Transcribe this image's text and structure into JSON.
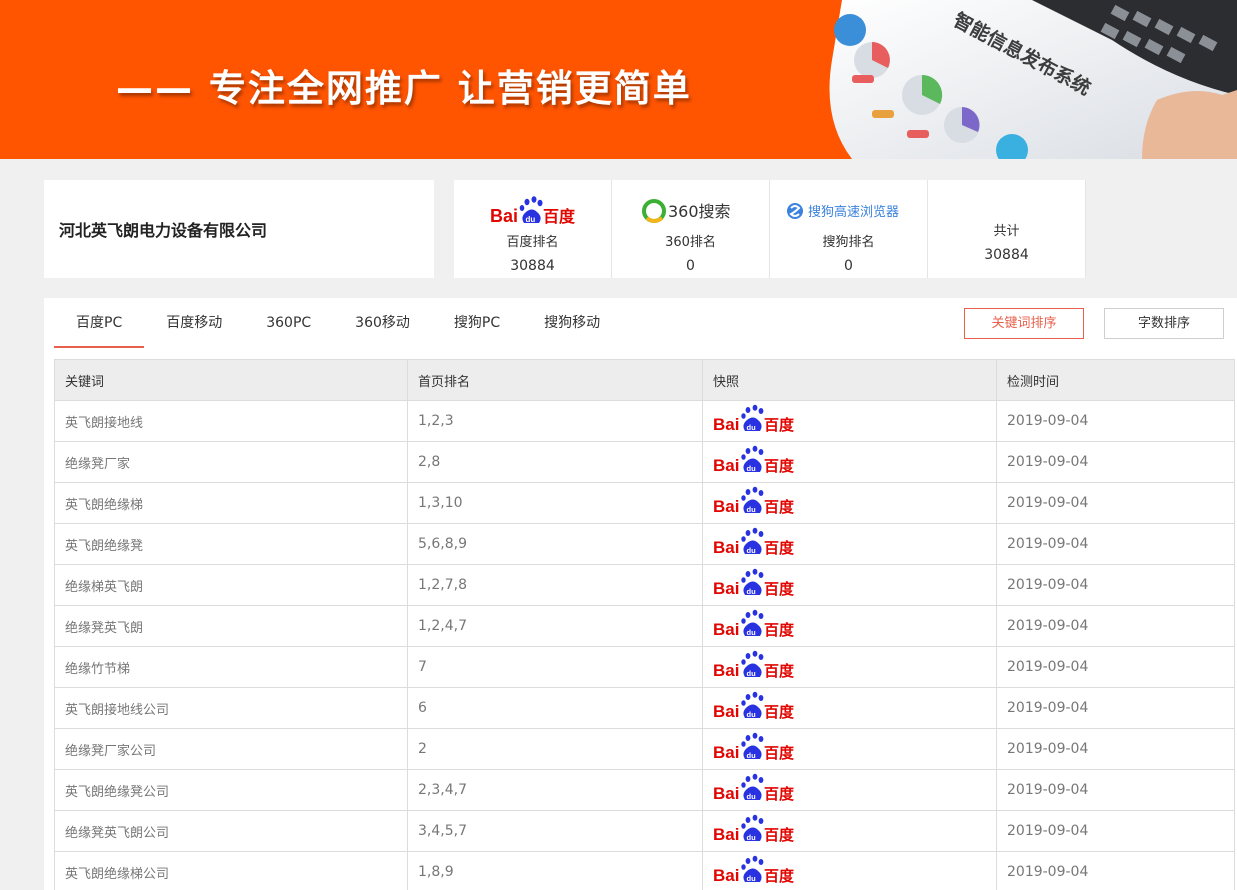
{
  "banner": {
    "slogan": "—— 专注全网推广    让营销更简单",
    "image_caption": "智能信息发布系统"
  },
  "company": {
    "name": "河北英飞朗电力设备有限公司"
  },
  "stats": [
    {
      "engine_icon": "baidu-logo-icon",
      "label": "百度排名",
      "value": "30884"
    },
    {
      "engine_icon": "360-search-logo-icon",
      "logo_text": "360搜索",
      "label": "360排名",
      "value": "0"
    },
    {
      "engine_icon": "sogou-browser-logo-icon",
      "logo_text": "搜狗高速浏览器",
      "label": "搜狗排名",
      "value": "0"
    },
    {
      "label": "共计",
      "value": "30884"
    }
  ],
  "tabs": [
    "百度PC",
    "百度移动",
    "360PC",
    "360移动",
    "搜狗PC",
    "搜狗移动"
  ],
  "active_tab": "百度PC",
  "sort_buttons": {
    "keyword": "关键词排序",
    "length": "字数排序"
  },
  "table": {
    "headers": [
      "关键词",
      "首页排名",
      "快照",
      "检测时间"
    ],
    "rows": [
      {
        "keyword": "英飞朗接地线",
        "rank": "1,2,3",
        "snapshot": "baidu-logo-icon",
        "date": "2019-09-04"
      },
      {
        "keyword": "绝缘凳厂家",
        "rank": "2,8",
        "snapshot": "baidu-logo-icon",
        "date": "2019-09-04"
      },
      {
        "keyword": "英飞朗绝缘梯",
        "rank": "1,3,10",
        "snapshot": "baidu-logo-icon",
        "date": "2019-09-04"
      },
      {
        "keyword": "英飞朗绝缘凳",
        "rank": "5,6,8,9",
        "snapshot": "baidu-logo-icon",
        "date": "2019-09-04"
      },
      {
        "keyword": "绝缘梯英飞朗",
        "rank": "1,2,7,8",
        "snapshot": "baidu-logo-icon",
        "date": "2019-09-04"
      },
      {
        "keyword": "绝缘凳英飞朗",
        "rank": "1,2,4,7",
        "snapshot": "baidu-logo-icon",
        "date": "2019-09-04"
      },
      {
        "keyword": "绝缘竹节梯",
        "rank": "7",
        "snapshot": "baidu-logo-icon",
        "date": "2019-09-04"
      },
      {
        "keyword": "英飞朗接地线公司",
        "rank": "6",
        "snapshot": "baidu-logo-icon",
        "date": "2019-09-04"
      },
      {
        "keyword": "绝缘凳厂家公司",
        "rank": "2",
        "snapshot": "baidu-logo-icon",
        "date": "2019-09-04"
      },
      {
        "keyword": "英飞朗绝缘凳公司",
        "rank": "2,3,4,7",
        "snapshot": "baidu-logo-icon",
        "date": "2019-09-04"
      },
      {
        "keyword": "绝缘凳英飞朗公司",
        "rank": "3,4,5,7",
        "snapshot": "baidu-logo-icon",
        "date": "2019-09-04"
      },
      {
        "keyword": "英飞朗绝缘梯公司",
        "rank": "1,8,9",
        "snapshot": "baidu-logo-icon",
        "date": "2019-09-04"
      }
    ]
  },
  "colors": {
    "banner_orange": "#ff5400",
    "accent_red": "#e8604c",
    "baidu_red": "#e10601",
    "baidu_blue": "#2932e1",
    "qihoo_green": "#3cb034",
    "sogou_blue": "#3a82dd"
  }
}
